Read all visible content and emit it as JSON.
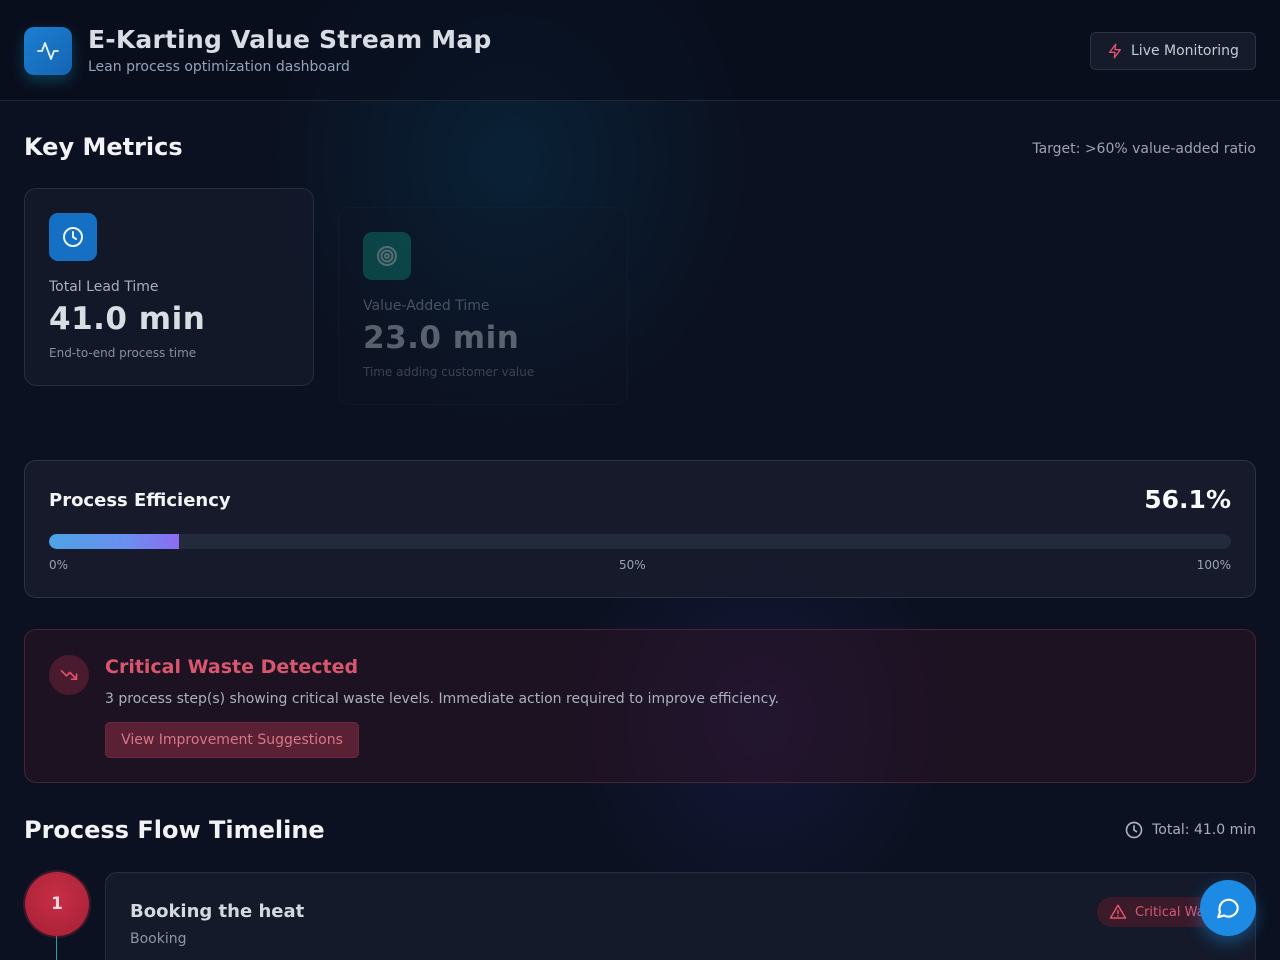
{
  "header": {
    "title": "E-Karting Value Stream Map",
    "subtitle": "Lean process optimization dashboard",
    "live_label": "Live Monitoring"
  },
  "metrics": {
    "heading": "Key Metrics",
    "target": "Target: >60% value-added ratio",
    "cards": [
      {
        "icon": "clock-icon",
        "label": "Total Lead Time",
        "value": "41.0 min",
        "desc": "End-to-end process time"
      },
      {
        "icon": "target-icon",
        "label": "Value-Added Time",
        "value": "23.0 min",
        "desc": "Time adding customer value"
      }
    ]
  },
  "efficiency": {
    "title": "Process Efficiency",
    "value_label": "56.1%",
    "bar_fill_fraction": 0.11,
    "ticks": [
      "0%",
      "50%",
      "100%"
    ]
  },
  "alert": {
    "title": "Critical Waste Detected",
    "message": "3 process step(s) showing critical waste levels. Immediate action required to improve efficiency.",
    "button": "View Improvement Suggestions"
  },
  "timeline": {
    "heading": "Process Flow Timeline",
    "total": "Total: 41.0 min",
    "steps": [
      {
        "number": "1",
        "title": "Booking the heat",
        "category": "Booking",
        "badge": "Critical Wa"
      }
    ]
  },
  "colors": {
    "accent": "#1d8be3",
    "critical": "#d9566f",
    "background": "#0b1120"
  }
}
